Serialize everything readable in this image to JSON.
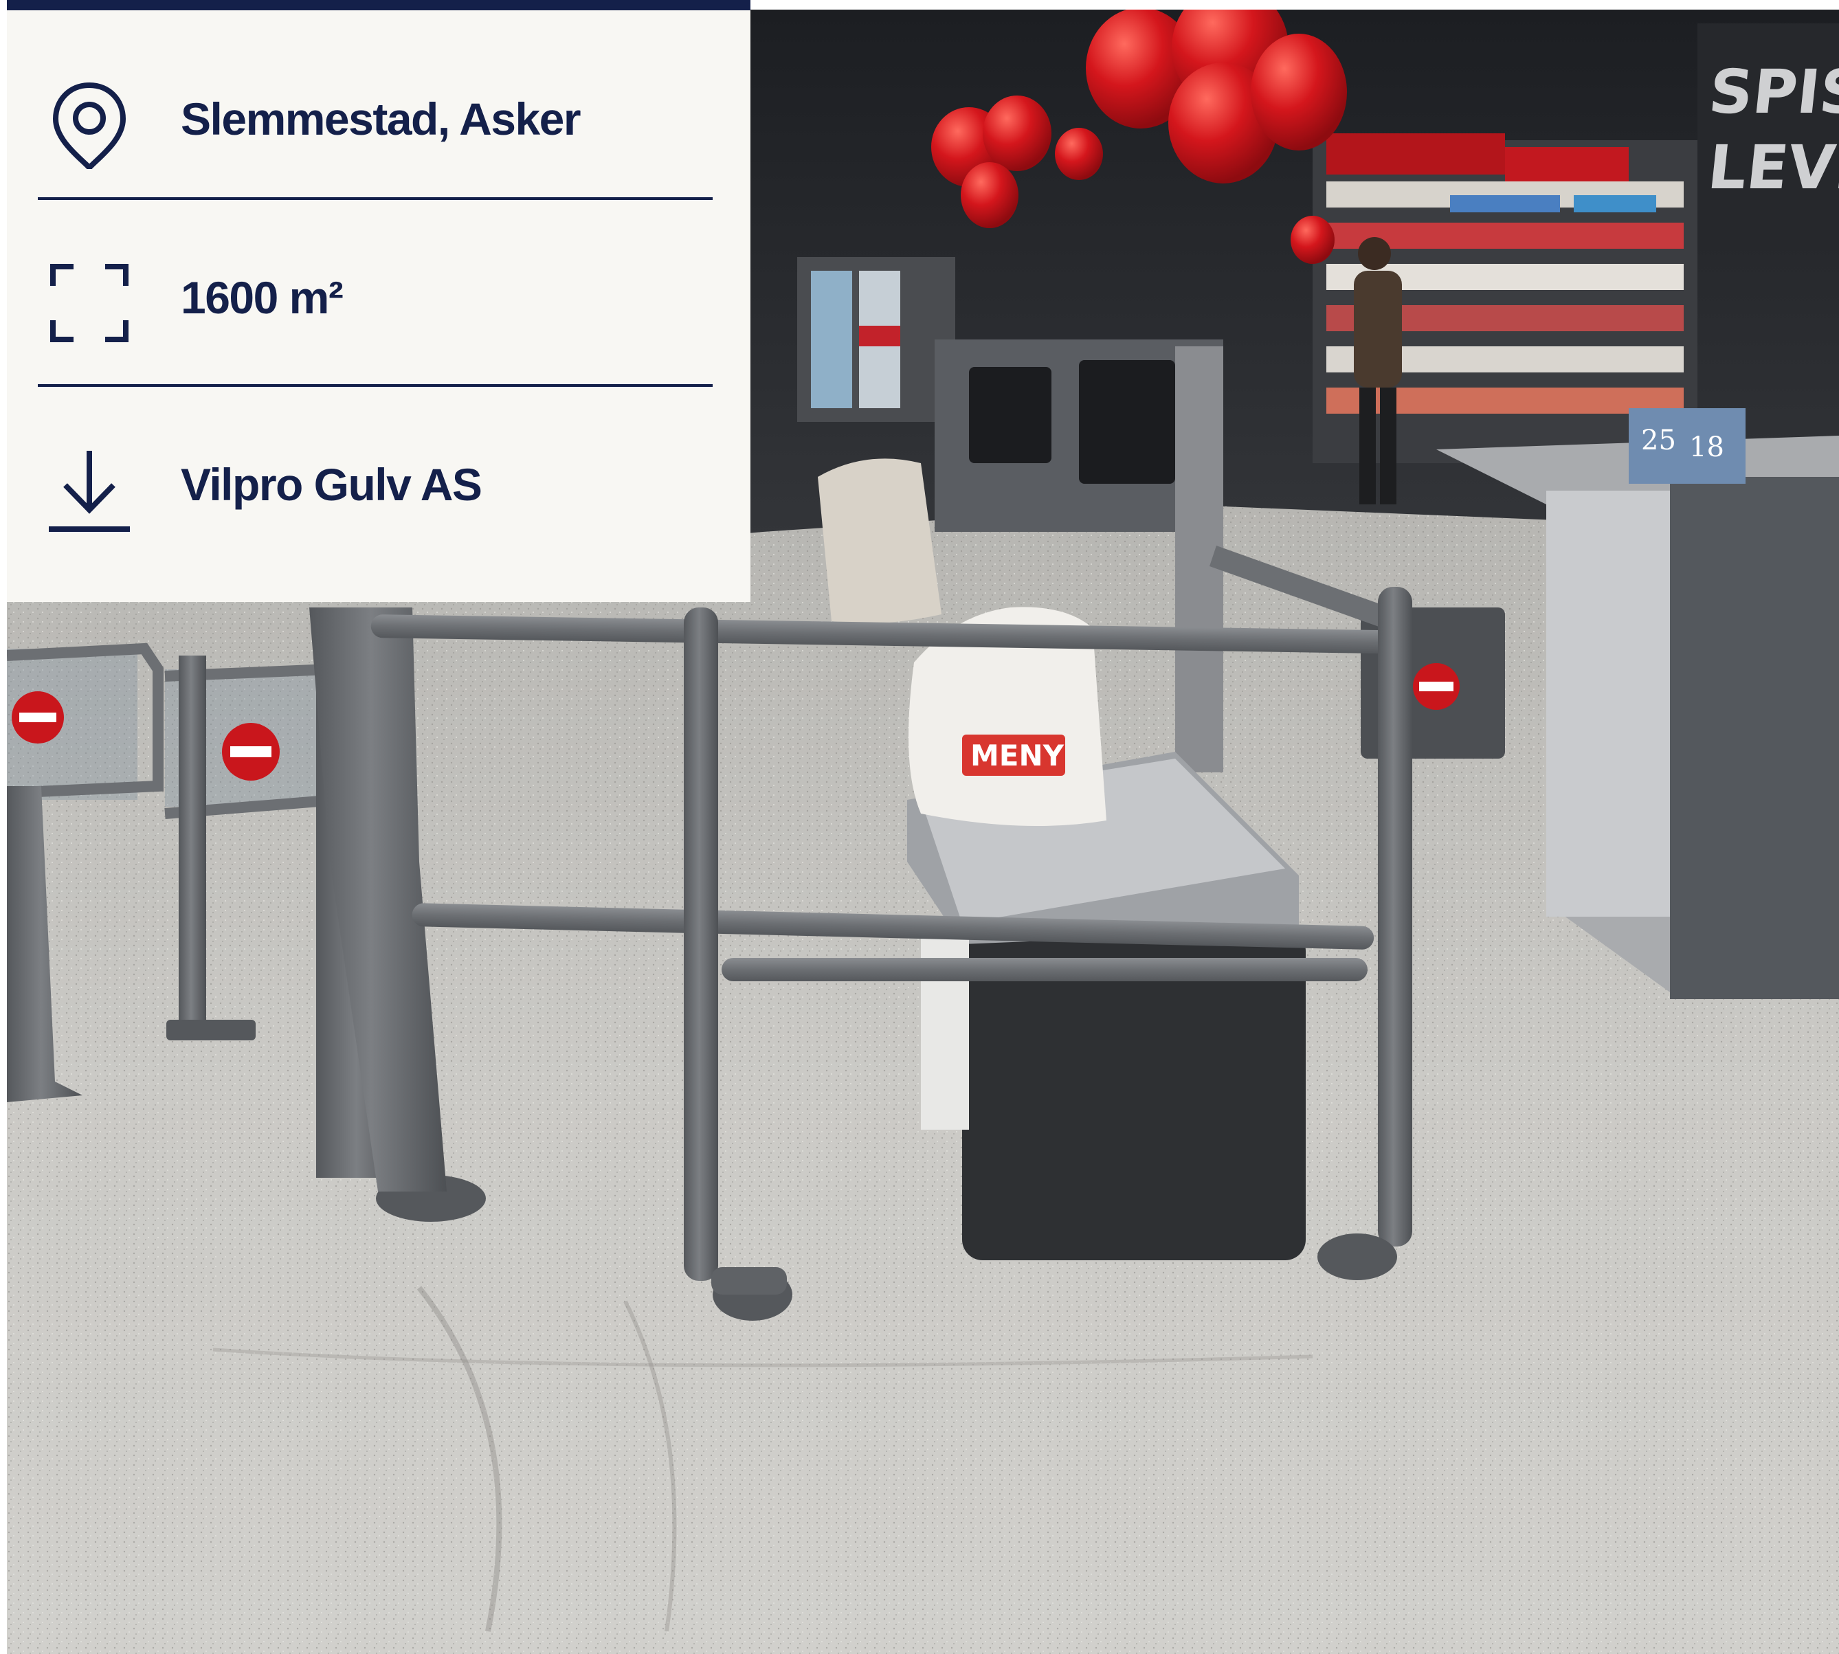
{
  "info_card": {
    "location": {
      "icon": "map-pin-icon",
      "text": "Slemmestad, Asker"
    },
    "area": {
      "icon": "area-frame-icon",
      "text": "1600 m²"
    },
    "supplier": {
      "icon": "download-arrow-icon",
      "text": "Vilpro Gulv AS"
    }
  },
  "photo": {
    "bag_print": "MENY",
    "shelf_price_tags": [
      "25",
      "18"
    ],
    "wall_sign": "SPISE LEVE"
  },
  "colors": {
    "card_background": "#f8f7f3",
    "card_text": "#14204a",
    "rail_gray": "#6c6f73",
    "balloon_red": "#d4161c",
    "floor_gray": "#c9c8c5"
  }
}
